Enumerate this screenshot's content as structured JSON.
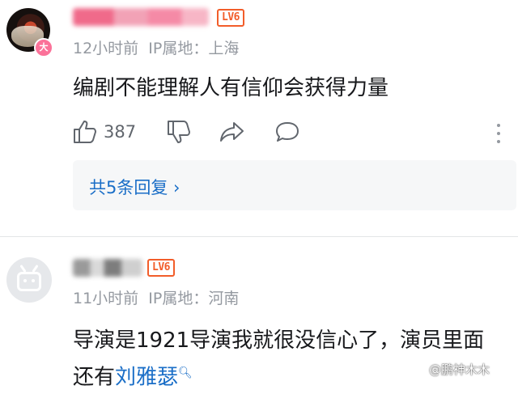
{
  "comments": [
    {
      "user_level": "LV6",
      "badge": "大",
      "timestamp": "12小时前",
      "ip_location": "IP属地：上海",
      "content": "编剧不能理解人有信仰会获得力量",
      "like_count": "387",
      "replies_label": "共5条回复 ›"
    },
    {
      "user_level": "LV6",
      "timestamp": "11小时前",
      "ip_location": "IP属地：河南",
      "content_line1": "导演是1921导演我就很没信心了，演员里面",
      "content_line2_prefix": "还有",
      "content_link": "刘雅瑟",
      "link_icon": "search-icon"
    }
  ],
  "watermark": "@鹏神木木",
  "colors": {
    "link": "#1a6ec7",
    "level_badge": "#f25d2a",
    "meta_text": "#9499a0",
    "vip_badge": "#fb7299"
  }
}
